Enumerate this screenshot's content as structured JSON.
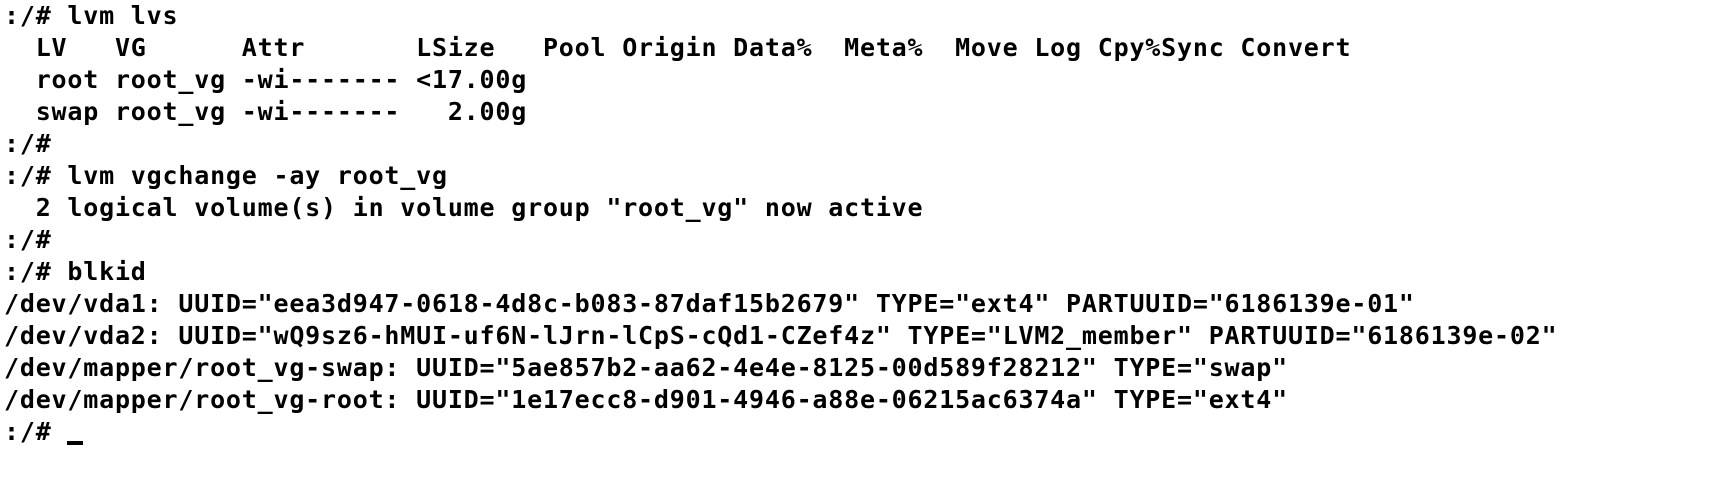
{
  "terminal": {
    "lines": [
      ":/# lvm lvs",
      "  LV   VG      Attr       LSize   Pool Origin Data%  Meta%  Move Log Cpy%Sync Convert",
      "  root root_vg -wi------- <17.00g",
      "  swap root_vg -wi-------   2.00g",
      ":/#",
      ":/# lvm vgchange -ay root_vg",
      "  2 logical volume(s) in volume group \"root_vg\" now active",
      ":/#",
      ":/# blkid",
      "/dev/vda1: UUID=\"eea3d947-0618-4d8c-b083-87daf15b2679\" TYPE=\"ext4\" PARTUUID=\"6186139e-01\"",
      "/dev/vda2: UUID=\"wQ9sz6-hMUI-uf6N-lJrn-lCpS-cQd1-CZef4z\" TYPE=\"LVM2_member\" PARTUUID=\"6186139e-02\"",
      "/dev/mapper/root_vg-swap: UUID=\"5ae857b2-aa62-4e4e-8125-00d589f28212\" TYPE=\"swap\"",
      "/dev/mapper/root_vg-root: UUID=\"1e17ecc8-d901-4946-a88e-06215ac6374a\" TYPE=\"ext4\"",
      ":/# "
    ]
  }
}
